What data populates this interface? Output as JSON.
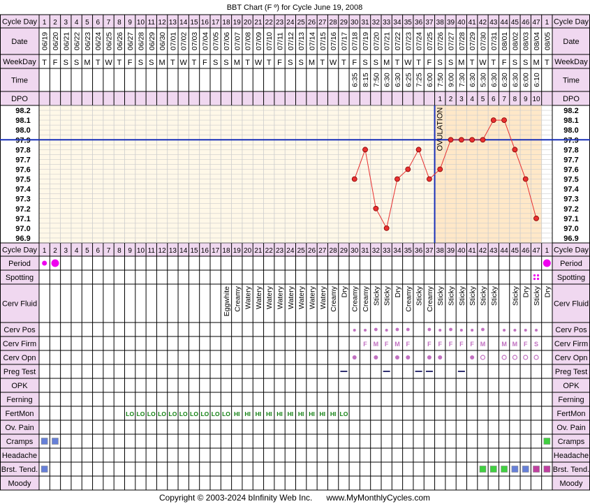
{
  "title": "BBT Chart (F º) for Cycle June 19, 2008",
  "footer": "Copyright © 2003-2024 bInfinity Web Inc.      www.MyMonthlyCycles.com",
  "colors": {
    "header_bg": "#F0D8F0",
    "plot_pre": "#FFF8E8",
    "plot_post": "#FFE8C8",
    "grid": "#CCCCCC",
    "temp_line": "#E83030",
    "coverline": "#1830B8",
    "ovulation_line": "#1830B8",
    "period": "#EE00EE",
    "cervix": "#C070C0",
    "cramps": "#6680D8",
    "green_box": "#40D040",
    "magenta_box": "#C040A0",
    "fertmon": "#108010"
  },
  "row_labels": {
    "cycle_day": "Cycle Day",
    "date": "Date",
    "weekday": "WeekDay",
    "time": "Time",
    "dpo": "DPO",
    "period": "Period",
    "spotting": "Spotting",
    "cerv_fluid": "Cerv Fluid",
    "cerv_pos": "Cerv Pos",
    "cerv_firm": "Cerv Firm",
    "cerv_opn": "Cerv Opn",
    "preg_test": "Preg Test",
    "opk": "OPK",
    "ferning": "Ferning",
    "fertmon": "FertMon",
    "ov_pain": "Ov. Pain",
    "cramps": "Cramps",
    "headache": "Headache",
    "brst_tend": "Brst. Tend.",
    "moody": "Moody"
  },
  "ovulation_label": "OVULATION",
  "cycle_days": [
    "1",
    "2",
    "3",
    "4",
    "5",
    "6",
    "7",
    "8",
    "9",
    "10",
    "11",
    "12",
    "13",
    "14",
    "15",
    "16",
    "17",
    "18",
    "19",
    "20",
    "21",
    "22",
    "23",
    "24",
    "25",
    "26",
    "27",
    "28",
    "29",
    "30",
    "31",
    "32",
    "33",
    "34",
    "35",
    "36",
    "37",
    "38",
    "39",
    "40",
    "41",
    "42",
    "43",
    "44",
    "45",
    "46",
    "47",
    "1"
  ],
  "dates": [
    "06/19",
    "06/20",
    "06/21",
    "06/22",
    "06/23",
    "06/24",
    "06/25",
    "06/26",
    "06/27",
    "06/28",
    "06/29",
    "06/30",
    "07/01",
    "07/02",
    "07/03",
    "07/04",
    "07/05",
    "07/06",
    "07/07",
    "07/08",
    "07/09",
    "07/10",
    "07/11",
    "07/12",
    "07/13",
    "07/14",
    "07/15",
    "07/16",
    "07/17",
    "07/18",
    "07/19",
    "07/20",
    "07/21",
    "07/22",
    "07/23",
    "07/24",
    "07/25",
    "07/26",
    "07/27",
    "07/28",
    "07/29",
    "07/30",
    "07/31",
    "08/01",
    "08/02",
    "08/03",
    "08/04",
    "08/05"
  ],
  "weekdays": [
    "T",
    "F",
    "S",
    "S",
    "M",
    "T",
    "W",
    "T",
    "F",
    "S",
    "S",
    "M",
    "T",
    "W",
    "T",
    "F",
    "S",
    "S",
    "M",
    "T",
    "W",
    "T",
    "F",
    "S",
    "S",
    "M",
    "T",
    "W",
    "T",
    "F",
    "S",
    "S",
    "M",
    "T",
    "W",
    "T",
    "F",
    "S",
    "S",
    "M",
    "T",
    "W",
    "T",
    "F",
    "S",
    "S",
    "M",
    "T"
  ],
  "times": [
    "",
    "",
    "",
    "",
    "",
    "",
    "",
    "",
    "",
    "",
    "",
    "",
    "",
    "",
    "",
    "",
    "",
    "",
    "",
    "",
    "",
    "",
    "",
    "",
    "",
    "",
    "",
    "",
    "",
    "6:35",
    "8:15",
    "7:50",
    "6:30",
    "6:30",
    "6:25",
    "7:25",
    "6:00",
    "7:50",
    "9:00",
    "7:30",
    "6:30",
    "5:30",
    "6:30",
    "6:30",
    "6:30",
    "6:00",
    "6:10",
    ""
  ],
  "dpo": [
    "",
    "",
    "",
    "",
    "",
    "",
    "",
    "",
    "",
    "",
    "",
    "",
    "",
    "",
    "",
    "",
    "",
    "",
    "",
    "",
    "",
    "",
    "",
    "",
    "",
    "",
    "",
    "",
    "",
    "",
    "",
    "",
    "",
    "",
    "",
    "",
    "",
    "1",
    "2",
    "3",
    "4",
    "5",
    "6",
    "7",
    "8",
    "9",
    "10",
    ""
  ],
  "cerv_fluid": [
    "",
    "",
    "",
    "",
    "",
    "",
    "",
    "",
    "",
    "",
    "",
    "",
    "",
    "",
    "",
    "",
    "",
    "Eggwhite",
    "Creamy",
    "Watery",
    "Watery",
    "Watery",
    "Watery",
    "Watery",
    "Watery",
    "Watery",
    "Watery",
    "Creamy",
    "Dry",
    "Creamy",
    "Creamy",
    "Sticky",
    "Sticky",
    "Dry",
    "Creamy",
    "Sticky",
    "Creamy",
    "Sticky",
    "Sticky",
    "Sticky",
    "Sticky",
    "Sticky",
    "Sticky",
    "",
    "Sticky",
    "Dry",
    "Sticky",
    "Dry",
    ""
  ],
  "cerv_firm": [
    "",
    "",
    "",
    "",
    "",
    "",
    "",
    "",
    "",
    "",
    "",
    "",
    "",
    "",
    "",
    "",
    "",
    "",
    "",
    "",
    "",
    "",
    "",
    "",
    "",
    "",
    "",
    "",
    "",
    "",
    "F",
    "M",
    "F",
    "M",
    "F",
    "",
    "F",
    "F",
    "F",
    "F",
    "F",
    "M",
    "",
    "M",
    "M",
    "F",
    "S",
    ""
  ],
  "fertmon": [
    "",
    "",
    "",
    "",
    "",
    "",
    "",
    "",
    "LO",
    "LO",
    "LO",
    "LO",
    "LO",
    "LO",
    "LO",
    "LO",
    "LO",
    "LO",
    "HI",
    "HI",
    "HI",
    "HI",
    "HI",
    "HI",
    "HI",
    "HI",
    "HI",
    "HI",
    "LO",
    "",
    "",
    "",
    "",
    "",
    "",
    "",
    "",
    "",
    "",
    "",
    "",
    "",
    "",
    "",
    "",
    "",
    ""
  ],
  "ovulation_day": "37",
  "chart_data": {
    "type": "line",
    "title": "BBT Chart (F º) for Cycle June 19, 2008",
    "xlabel": "Cycle Day",
    "ylabel": "",
    "ylim": [
      96.9,
      98.2
    ],
    "yticks": [
      "98.2",
      "98.1",
      "98.0",
      "97.9",
      "97.8",
      "97.7",
      "97.6",
      "97.5",
      "97.4",
      "97.3",
      "97.2",
      "97.1",
      "97.0",
      "96.9"
    ],
    "grid": true,
    "coverline": 97.9,
    "ovulation_cycle_day": 37,
    "series": [
      {
        "x": [
          30,
          31,
          32,
          33,
          34,
          35,
          36,
          37,
          38,
          39,
          40,
          41,
          42,
          43,
          44,
          45,
          46,
          47
        ],
        "values": [
          97.5,
          97.8,
          97.2,
          97.0,
          97.5,
          97.6,
          97.8,
          97.5,
          97.6,
          97.9,
          97.9,
          97.9,
          97.9,
          98.1,
          98.1,
          97.8,
          97.5,
          97.1
        ]
      }
    ]
  }
}
